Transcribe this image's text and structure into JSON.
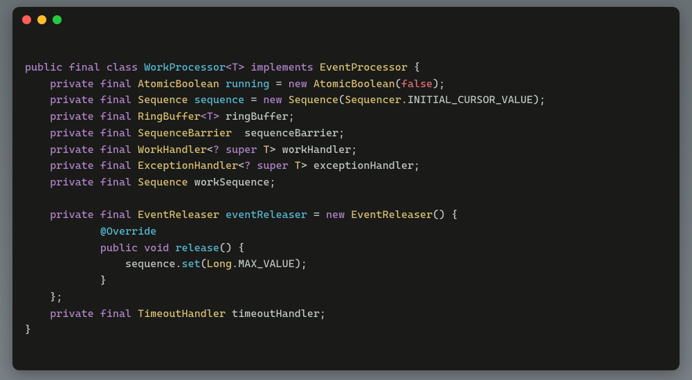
{
  "lines": [
    [
      {
        "cls": "tok-kw",
        "t": "public "
      },
      {
        "cls": "tok-kw",
        "t": "final "
      },
      {
        "cls": "tok-kw",
        "t": "class "
      },
      {
        "cls": "tok-name",
        "t": "WorkProcessor"
      },
      {
        "cls": "tok-gen",
        "t": "<T>"
      },
      {
        "cls": "tok-punct",
        "t": " "
      },
      {
        "cls": "tok-kw",
        "t": "implements "
      },
      {
        "cls": "tok-type",
        "t": "EventProcessor"
      },
      {
        "cls": "tok-punct",
        "t": " {"
      }
    ],
    [
      {
        "cls": "tok-punct",
        "t": "    "
      },
      {
        "cls": "tok-kw",
        "t": "private "
      },
      {
        "cls": "tok-kw",
        "t": "final "
      },
      {
        "cls": "tok-type",
        "t": "AtomicBoolean "
      },
      {
        "cls": "tok-name",
        "t": "running"
      },
      {
        "cls": "tok-punct",
        "t": " = "
      },
      {
        "cls": "tok-kw",
        "t": "new "
      },
      {
        "cls": "tok-type",
        "t": "AtomicBoolean"
      },
      {
        "cls": "tok-punct",
        "t": "("
      },
      {
        "cls": "tok-false",
        "t": "false"
      },
      {
        "cls": "tok-punct",
        "t": ");"
      }
    ],
    [
      {
        "cls": "tok-punct",
        "t": "    "
      },
      {
        "cls": "tok-kw",
        "t": "private "
      },
      {
        "cls": "tok-kw",
        "t": "final "
      },
      {
        "cls": "tok-type",
        "t": "Sequence "
      },
      {
        "cls": "tok-name",
        "t": "sequence"
      },
      {
        "cls": "tok-punct",
        "t": " = "
      },
      {
        "cls": "tok-kw",
        "t": "new "
      },
      {
        "cls": "tok-type",
        "t": "Sequence"
      },
      {
        "cls": "tok-punct",
        "t": "("
      },
      {
        "cls": "tok-type",
        "t": "Sequencer"
      },
      {
        "cls": "tok-punct",
        "t": "."
      },
      {
        "cls": "tok-prop",
        "t": "INITIAL_CURSOR_VALUE"
      },
      {
        "cls": "tok-punct",
        "t": ");"
      }
    ],
    [
      {
        "cls": "tok-punct",
        "t": "    "
      },
      {
        "cls": "tok-kw",
        "t": "private "
      },
      {
        "cls": "tok-kw",
        "t": "final "
      },
      {
        "cls": "tok-type",
        "t": "RingBuffer"
      },
      {
        "cls": "tok-gen",
        "t": "<T>"
      },
      {
        "cls": "tok-punct",
        "t": " "
      },
      {
        "cls": "tok-var",
        "t": "ringBuffer"
      },
      {
        "cls": "tok-punct",
        "t": ";"
      }
    ],
    [
      {
        "cls": "tok-punct",
        "t": "    "
      },
      {
        "cls": "tok-kw",
        "t": "private "
      },
      {
        "cls": "tok-kw",
        "t": "final "
      },
      {
        "cls": "tok-type",
        "t": "SequenceBarrier  "
      },
      {
        "cls": "tok-var",
        "t": "sequenceBarrier"
      },
      {
        "cls": "tok-punct",
        "t": ";"
      }
    ],
    [
      {
        "cls": "tok-punct",
        "t": "    "
      },
      {
        "cls": "tok-kw",
        "t": "private "
      },
      {
        "cls": "tok-kw",
        "t": "final "
      },
      {
        "cls": "tok-type",
        "t": "WorkHandler"
      },
      {
        "cls": "tok-punct",
        "t": "<"
      },
      {
        "cls": "tok-kw",
        "t": "? super "
      },
      {
        "cls": "tok-type",
        "t": "T"
      },
      {
        "cls": "tok-punct",
        "t": "> "
      },
      {
        "cls": "tok-var",
        "t": "workHandler"
      },
      {
        "cls": "tok-punct",
        "t": ";"
      }
    ],
    [
      {
        "cls": "tok-punct",
        "t": "    "
      },
      {
        "cls": "tok-kw",
        "t": "private "
      },
      {
        "cls": "tok-kw",
        "t": "final "
      },
      {
        "cls": "tok-type",
        "t": "ExceptionHandler"
      },
      {
        "cls": "tok-punct",
        "t": "<"
      },
      {
        "cls": "tok-kw",
        "t": "? super "
      },
      {
        "cls": "tok-type",
        "t": "T"
      },
      {
        "cls": "tok-punct",
        "t": "> "
      },
      {
        "cls": "tok-var",
        "t": "exceptionHandler"
      },
      {
        "cls": "tok-punct",
        "t": ";"
      }
    ],
    [
      {
        "cls": "tok-punct",
        "t": "    "
      },
      {
        "cls": "tok-kw",
        "t": "private "
      },
      {
        "cls": "tok-kw",
        "t": "final "
      },
      {
        "cls": "tok-type",
        "t": "Sequence "
      },
      {
        "cls": "tok-var",
        "t": "workSequence"
      },
      {
        "cls": "tok-punct",
        "t": ";"
      }
    ],
    [
      {
        "cls": "tok-punct",
        "t": ""
      }
    ],
    [
      {
        "cls": "tok-punct",
        "t": "    "
      },
      {
        "cls": "tok-kw",
        "t": "private "
      },
      {
        "cls": "tok-kw",
        "t": "final "
      },
      {
        "cls": "tok-type",
        "t": "EventReleaser "
      },
      {
        "cls": "tok-name",
        "t": "eventReleaser"
      },
      {
        "cls": "tok-punct",
        "t": " = "
      },
      {
        "cls": "tok-kw",
        "t": "new "
      },
      {
        "cls": "tok-type",
        "t": "EventReleaser"
      },
      {
        "cls": "tok-punct",
        "t": "() {"
      }
    ],
    [
      {
        "cls": "tok-punct",
        "t": "            "
      },
      {
        "cls": "tok-ann",
        "t": "@Override"
      }
    ],
    [
      {
        "cls": "tok-punct",
        "t": "            "
      },
      {
        "cls": "tok-kw",
        "t": "public "
      },
      {
        "cls": "tok-kw",
        "t": "void "
      },
      {
        "cls": "tok-fn",
        "t": "release"
      },
      {
        "cls": "tok-punct",
        "t": "() {"
      }
    ],
    [
      {
        "cls": "tok-punct",
        "t": "                "
      },
      {
        "cls": "tok-var",
        "t": "sequence"
      },
      {
        "cls": "tok-punct",
        "t": "."
      },
      {
        "cls": "tok-fn",
        "t": "set"
      },
      {
        "cls": "tok-punct",
        "t": "("
      },
      {
        "cls": "tok-type",
        "t": "Long"
      },
      {
        "cls": "tok-punct",
        "t": "."
      },
      {
        "cls": "tok-prop",
        "t": "MAX_VALUE"
      },
      {
        "cls": "tok-punct",
        "t": ");"
      }
    ],
    [
      {
        "cls": "tok-punct",
        "t": "            }"
      }
    ],
    [
      {
        "cls": "tok-punct",
        "t": "    };"
      }
    ],
    [
      {
        "cls": "tok-punct",
        "t": "    "
      },
      {
        "cls": "tok-kw",
        "t": "private "
      },
      {
        "cls": "tok-kw",
        "t": "final "
      },
      {
        "cls": "tok-type",
        "t": "TimeoutHandler "
      },
      {
        "cls": "tok-var",
        "t": "timeoutHandler"
      },
      {
        "cls": "tok-punct",
        "t": ";"
      }
    ],
    [
      {
        "cls": "tok-punct",
        "t": "}"
      }
    ]
  ]
}
